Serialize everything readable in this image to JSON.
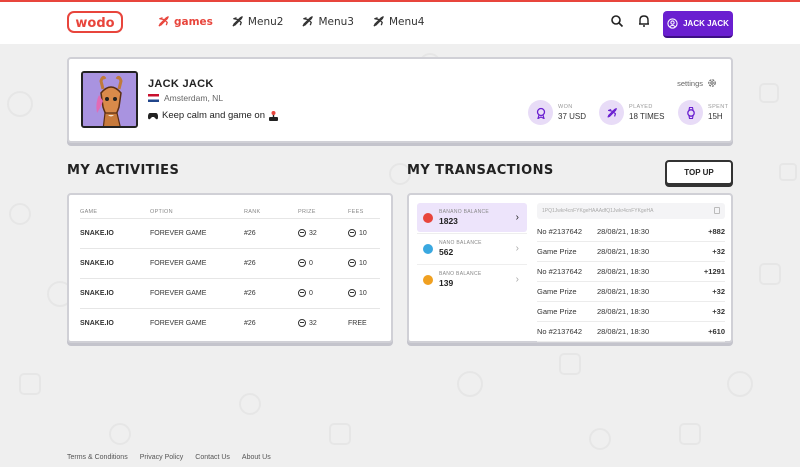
{
  "header": {
    "logo": "wodo",
    "nav": [
      {
        "label": "games",
        "active": true
      },
      {
        "label": "Menu2",
        "active": false
      },
      {
        "label": "Menu3",
        "active": false
      },
      {
        "label": "Menu4",
        "active": false
      }
    ],
    "icons": [
      "search-icon",
      "bell-icon",
      "user-icon"
    ],
    "user_button": "JACK JACK"
  },
  "profile": {
    "name": "JACK JACK",
    "location": "Amsterdam, NL",
    "motto": "Keep calm and game on",
    "settings_label": "settings",
    "stats": [
      {
        "label": "WON",
        "value": "37 USD",
        "icon": "medal-icon"
      },
      {
        "label": "PLAYED",
        "value": "18 TIMES",
        "icon": "rocket-icon"
      },
      {
        "label": "SPENT",
        "value": "15H",
        "icon": "watch-icon"
      }
    ]
  },
  "activities": {
    "title": "MY ACTIVITIES",
    "columns": [
      "GAME",
      "OPTION",
      "RANK",
      "PRIZE",
      "FEES"
    ],
    "rows": [
      {
        "game": "SNAKE.IO",
        "option": "FOREVER GAME",
        "rank": "#26",
        "prize": "32",
        "fees": "10",
        "fees_coin": true
      },
      {
        "game": "SNAKE.IO",
        "option": "FOREVER GAME",
        "rank": "#26",
        "prize": "0",
        "fees": "10",
        "fees_coin": true
      },
      {
        "game": "SNAKE.IO",
        "option": "FOREVER GAME",
        "rank": "#26",
        "prize": "0",
        "fees": "10",
        "fees_coin": true
      },
      {
        "game": "SNAKE.IO",
        "option": "FOREVER GAME",
        "rank": "#26",
        "prize": "32",
        "fees": "FREE",
        "fees_coin": false
      }
    ]
  },
  "transactions": {
    "title": "MY TRANSACTIONS",
    "topup_label": "TOP UP",
    "balances": [
      {
        "label": "BANANO BALANCE",
        "value": "1823",
        "color": "#e8453c",
        "active": true
      },
      {
        "label": "NANO BALANCE",
        "value": "562",
        "color": "#3aa8e0",
        "active": false
      },
      {
        "label": "BANO BALANCE",
        "value": "139",
        "color": "#f0a020",
        "active": false
      }
    ],
    "address": "1PQ1Jwkr4cnFYKgeHAAAdfQ1Jwkr4cnFYKgeHA",
    "rows": [
      {
        "ref": "No #2137642",
        "date": "28/08/21, 18:30",
        "amount": "+882"
      },
      {
        "ref": "Game Prize",
        "date": "28/08/21, 18:30",
        "amount": "+32"
      },
      {
        "ref": "No #2137642",
        "date": "28/08/21, 18:30",
        "amount": "+1291"
      },
      {
        "ref": "Game Prize",
        "date": "28/08/21, 18:30",
        "amount": "+32"
      },
      {
        "ref": "Game Prize",
        "date": "28/08/21, 18:30",
        "amount": "+32"
      },
      {
        "ref": "No #2137642",
        "date": "28/08/21, 18:30",
        "amount": "+610"
      }
    ]
  },
  "footer": [
    "Terms & Conditions",
    "Privacy Policy",
    "Contact Us",
    "About Us"
  ],
  "colors": {
    "accent": "#e8453c",
    "brand_purple": "#6a1fd0",
    "light_purple": "#e8dcf7"
  }
}
